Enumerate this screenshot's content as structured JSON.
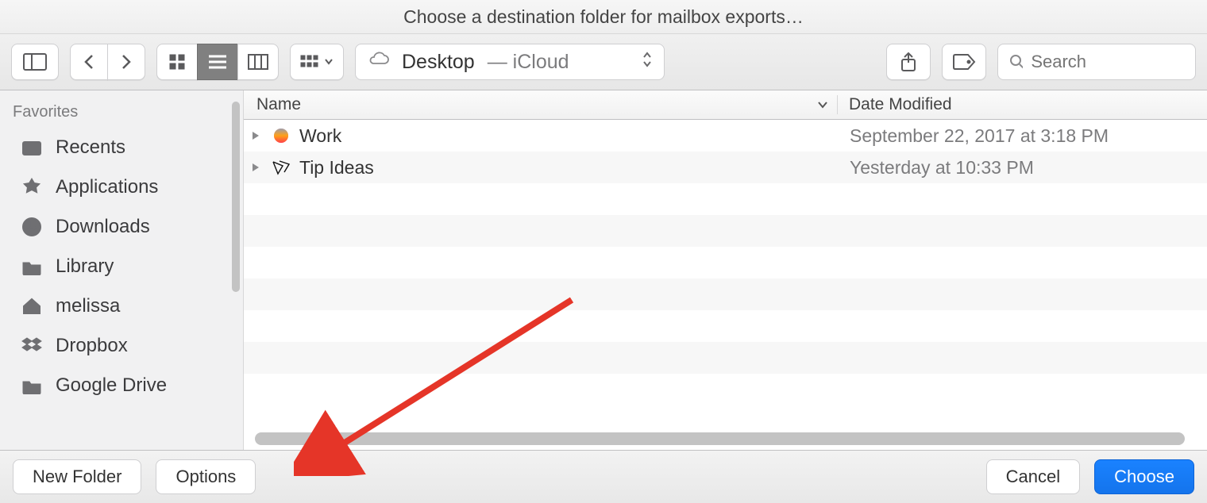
{
  "title": "Choose a destination folder for mailbox exports…",
  "location": {
    "name": "Desktop",
    "source": "iCloud"
  },
  "search": {
    "placeholder": "Search"
  },
  "columns": {
    "name": "Name",
    "date": "Date Modified"
  },
  "sidebar": {
    "header": "Favorites",
    "items": [
      {
        "label": "Recents",
        "icon": "recents-icon"
      },
      {
        "label": "Applications",
        "icon": "applications-icon"
      },
      {
        "label": "Downloads",
        "icon": "downloads-icon"
      },
      {
        "label": "Library",
        "icon": "folder-icon"
      },
      {
        "label": "melissa",
        "icon": "home-icon"
      },
      {
        "label": "Dropbox",
        "icon": "dropbox-icon"
      },
      {
        "label": "Google Drive",
        "icon": "folder-icon"
      }
    ]
  },
  "files": [
    {
      "name": "Work",
      "date": "September 22, 2017 at 3:18 PM",
      "icon": "folder-color-icon"
    },
    {
      "name": "Tip Ideas",
      "date": "Yesterday at 10:33 PM",
      "icon": "folder-dark-icon"
    }
  ],
  "buttons": {
    "new_folder": "New Folder",
    "options": "Options",
    "cancel": "Cancel",
    "choose": "Choose"
  }
}
